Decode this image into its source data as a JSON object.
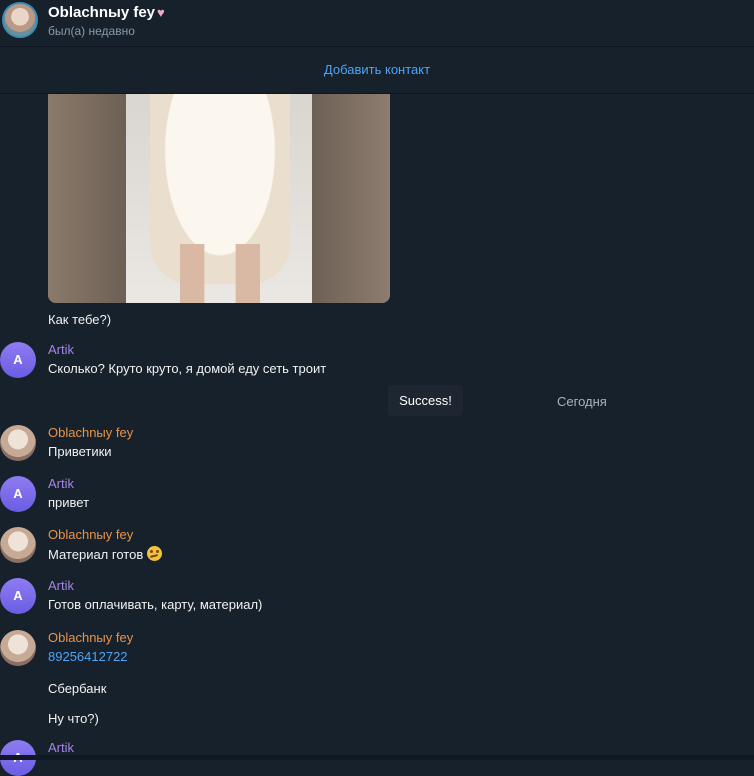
{
  "header": {
    "name": "Oblachnыy fey",
    "heart_icon": "heart-icon",
    "status": "был(а) недавно"
  },
  "add_contact": {
    "label": "Добавить контакт"
  },
  "media_message": {
    "caption": "Как тебе?)"
  },
  "toast": {
    "text": "Success!"
  },
  "date_separator": {
    "label": "Сегодня"
  },
  "messages": [
    {
      "sender": "Artik",
      "avatar_letter": "A",
      "text": "Сколько? Круто круто, я домой еду сеть троит"
    },
    {
      "sender": "Oblachnыy fey",
      "text": "Приветики"
    },
    {
      "sender": "Artik",
      "avatar_letter": "A",
      "text": "привет"
    },
    {
      "sender": "Oblachnыy fey",
      "text": "Материал готов",
      "emoji": "smirk-emoji"
    },
    {
      "sender": "Artik",
      "avatar_letter": "A",
      "text": "Готов оплачивать, карту, материал)"
    },
    {
      "sender": "Oblachnыy fey",
      "text": "89256412722",
      "extra": [
        "Сбербанк",
        "Ну что?)"
      ]
    },
    {
      "sender": "Artik",
      "avatar_letter": "A"
    }
  ],
  "colors": {
    "background": "#17212b",
    "accent": "#4ea4f6",
    "artik_name": "#a585e6",
    "oblachnyy_name": "#e8934a"
  }
}
